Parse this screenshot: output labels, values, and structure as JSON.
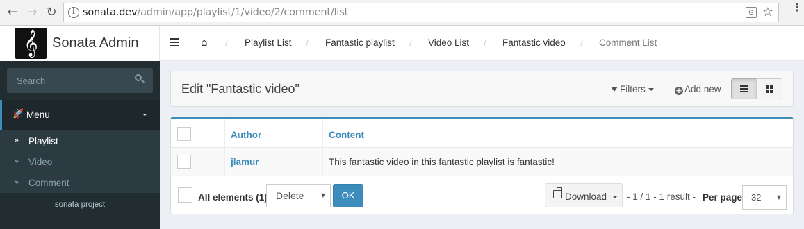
{
  "browser": {
    "url_host": "sonata.dev",
    "url_path": "/admin/app/playlist/1/video/2/comment/list",
    "back_icon": "←",
    "forward_icon": "→",
    "reload_icon": "↻",
    "info_icon": "i",
    "translate_icon": "G",
    "star_icon": "☆",
    "menu_icon": "⋮"
  },
  "header": {
    "logo_glyph": "𝄞",
    "app_name": "Sonata Admin",
    "home_icon": "⌂",
    "breadcrumbs": [
      {
        "label": "Playlist List"
      },
      {
        "label": "Fantastic playlist"
      },
      {
        "label": "Video List"
      },
      {
        "label": "Fantastic video"
      },
      {
        "label": "Comment List"
      }
    ],
    "separator": "/"
  },
  "sidebar": {
    "search_placeholder": "Search",
    "menu_label": "Menu",
    "menu_icon": "🚀",
    "chevron_icon": "⌄",
    "items": [
      {
        "label": "Playlist",
        "active": true
      },
      {
        "label": "Video",
        "active": false
      },
      {
        "label": "Comment",
        "active": false
      }
    ],
    "item_chevron": "»",
    "footer": "sonata project"
  },
  "content": {
    "title": "Edit \"Fantastic video\"",
    "filters_label": "Filters",
    "add_new_label": "Add new",
    "plus_icon": "+",
    "table": {
      "columns": [
        "Author",
        "Content"
      ],
      "rows": [
        {
          "author": "jlamur",
          "content": "This fantastic video in this fantastic playlist is fantastic!"
        }
      ]
    },
    "footer": {
      "all_elements_label": "All elements (1)",
      "batch_action": "Delete",
      "ok_label": "OK",
      "download_label": "Download",
      "pager_info": "- 1 / 1 - 1 result -",
      "per_page_label": "Per page",
      "per_page_value": "32",
      "select_arrow": "▼"
    }
  }
}
